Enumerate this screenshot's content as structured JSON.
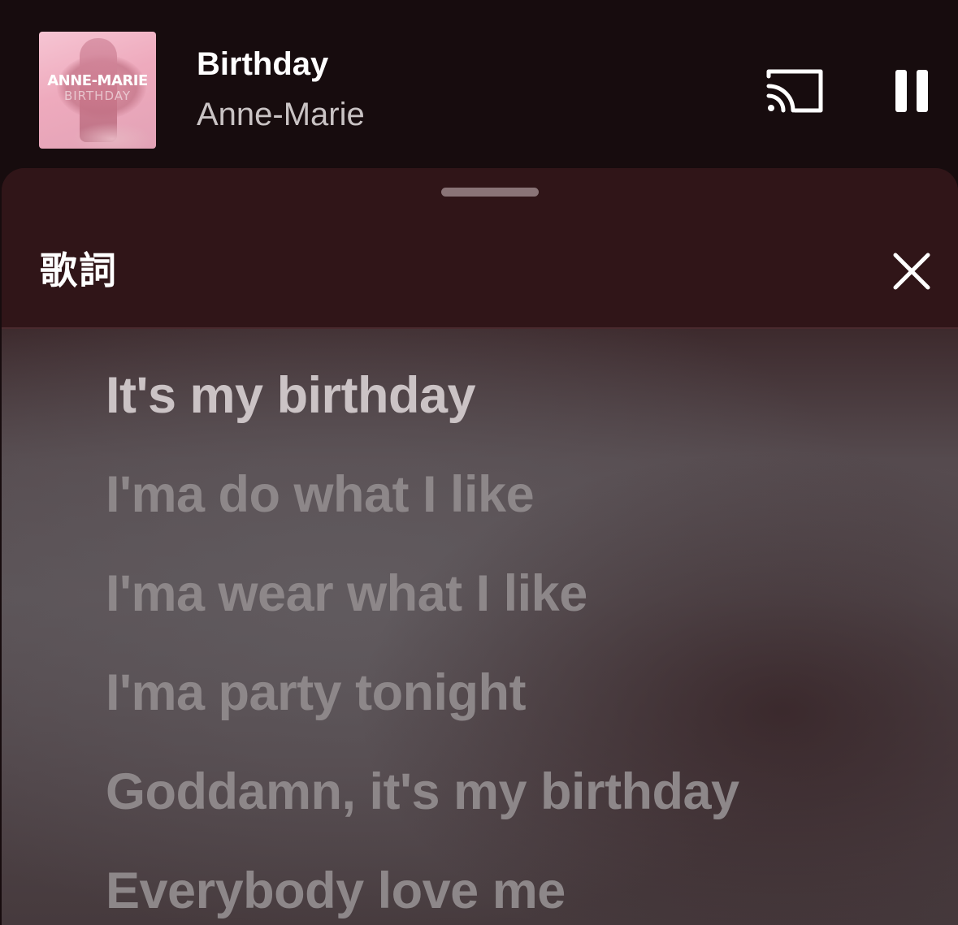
{
  "now_playing": {
    "album_art": {
      "artist_text": "ANNE-MARIE",
      "title_text": "BIRTHDAY"
    },
    "title": "Birthday",
    "artist": "Anne-Marie",
    "cast_icon": "cast-icon",
    "pause_icon": "pause-icon"
  },
  "lyrics_sheet": {
    "title": "歌詞",
    "close_icon": "close-icon",
    "lines": [
      "It's my birthday",
      "I'ma do what I like",
      "I'ma wear what I like",
      "I'ma party tonight",
      "Goddamn, it's my birthday",
      "Everybody love me"
    ],
    "active_line_index": 0
  },
  "colors": {
    "background": "#170c0e",
    "sheet_header": "#301518",
    "active_lyric": "#cbc3c5",
    "inactive_lyric": "#8d8789"
  }
}
